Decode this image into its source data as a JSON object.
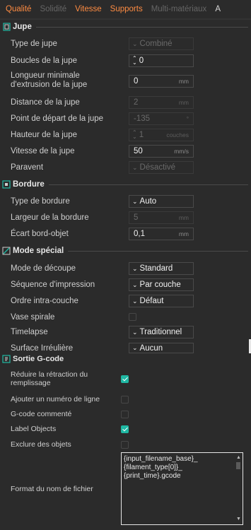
{
  "tabs": [
    {
      "label": "Qualité",
      "state": "active"
    },
    {
      "label": "Solidité",
      "state": "disabled"
    },
    {
      "label": "Vitesse",
      "state": "active"
    },
    {
      "label": "Supports",
      "state": "active"
    },
    {
      "label": "Multi-matériaux",
      "state": "disabled"
    },
    {
      "label": "A",
      "state": "normal"
    }
  ],
  "jupe": {
    "title": "Jupe",
    "rows": {
      "type_label": "Type de jupe",
      "type_value": "Combiné",
      "boucles_label": "Boucles de la jupe",
      "boucles_value": "0",
      "longueur_label_1": "Longueur minimale",
      "longueur_label_2": "d'extrusion de la jupe",
      "longueur_value": "0",
      "longueur_unit": "mm",
      "distance_label": "Distance de la jupe",
      "distance_value": "2",
      "distance_unit": "mm",
      "depart_label": "Point de départ de la jupe",
      "depart_value": "-135",
      "depart_unit": "°",
      "hauteur_label": "Hauteur de la jupe",
      "hauteur_value": "1",
      "hauteur_unit": "couches",
      "vitesse_label": "Vitesse de la jupe",
      "vitesse_value": "50",
      "vitesse_unit": "mm/s",
      "paravent_label": "Paravent",
      "paravent_value": "Désactivé"
    }
  },
  "bordure": {
    "title": "Bordure",
    "rows": {
      "type_label": "Type de bordure",
      "type_value": "Auto",
      "largeur_label": "Largeur de la bordure",
      "largeur_value": "5",
      "largeur_unit": "mm",
      "ecart_label": "Écart bord-objet",
      "ecart_value": "0,1",
      "ecart_unit": "mm"
    }
  },
  "mode": {
    "title": "Mode spécial",
    "rows": {
      "decoupe_label": "Mode de découpe",
      "decoupe_value": "Standard",
      "sequence_label": "Séquence d'impression",
      "sequence_value": "Par couche",
      "ordre_label": "Ordre intra-couche",
      "ordre_value": "Défaut",
      "vase_label": "Vase spirale",
      "timelapse_label": "Timelapse",
      "timelapse_value": "Traditionnel",
      "surface_label": "Surface Irréulière",
      "surface_value": "Aucun"
    }
  },
  "gcode": {
    "title": "Sortie G-code",
    "reduire_label_1": "Réduire la rétraction du",
    "reduire_label_2": "remplissage",
    "reduire_checked": true,
    "numero_label": "Ajouter un numéro de ligne",
    "numero_checked": false,
    "commente_label": "G-code commenté",
    "commente_checked": false,
    "label_objects_label": "Label Objects",
    "label_objects_checked": true,
    "exclure_label": "Exclure des objets",
    "exclure_checked": false,
    "format_label": "Format du nom de fichier",
    "format_line1": "{input_filename_base}_",
    "format_line2": "{filament_type[0]}_",
    "format_line3": "{print_time}.gcode"
  },
  "colors": {
    "accent": "#ff8c42",
    "check": "#1fb8a3",
    "background": "#2b2b2b"
  },
  "icons": {
    "jupe": "skirt-icon",
    "bordure": "brim-icon",
    "mode": "special-mode-icon",
    "gcode": "gcode-icon"
  }
}
